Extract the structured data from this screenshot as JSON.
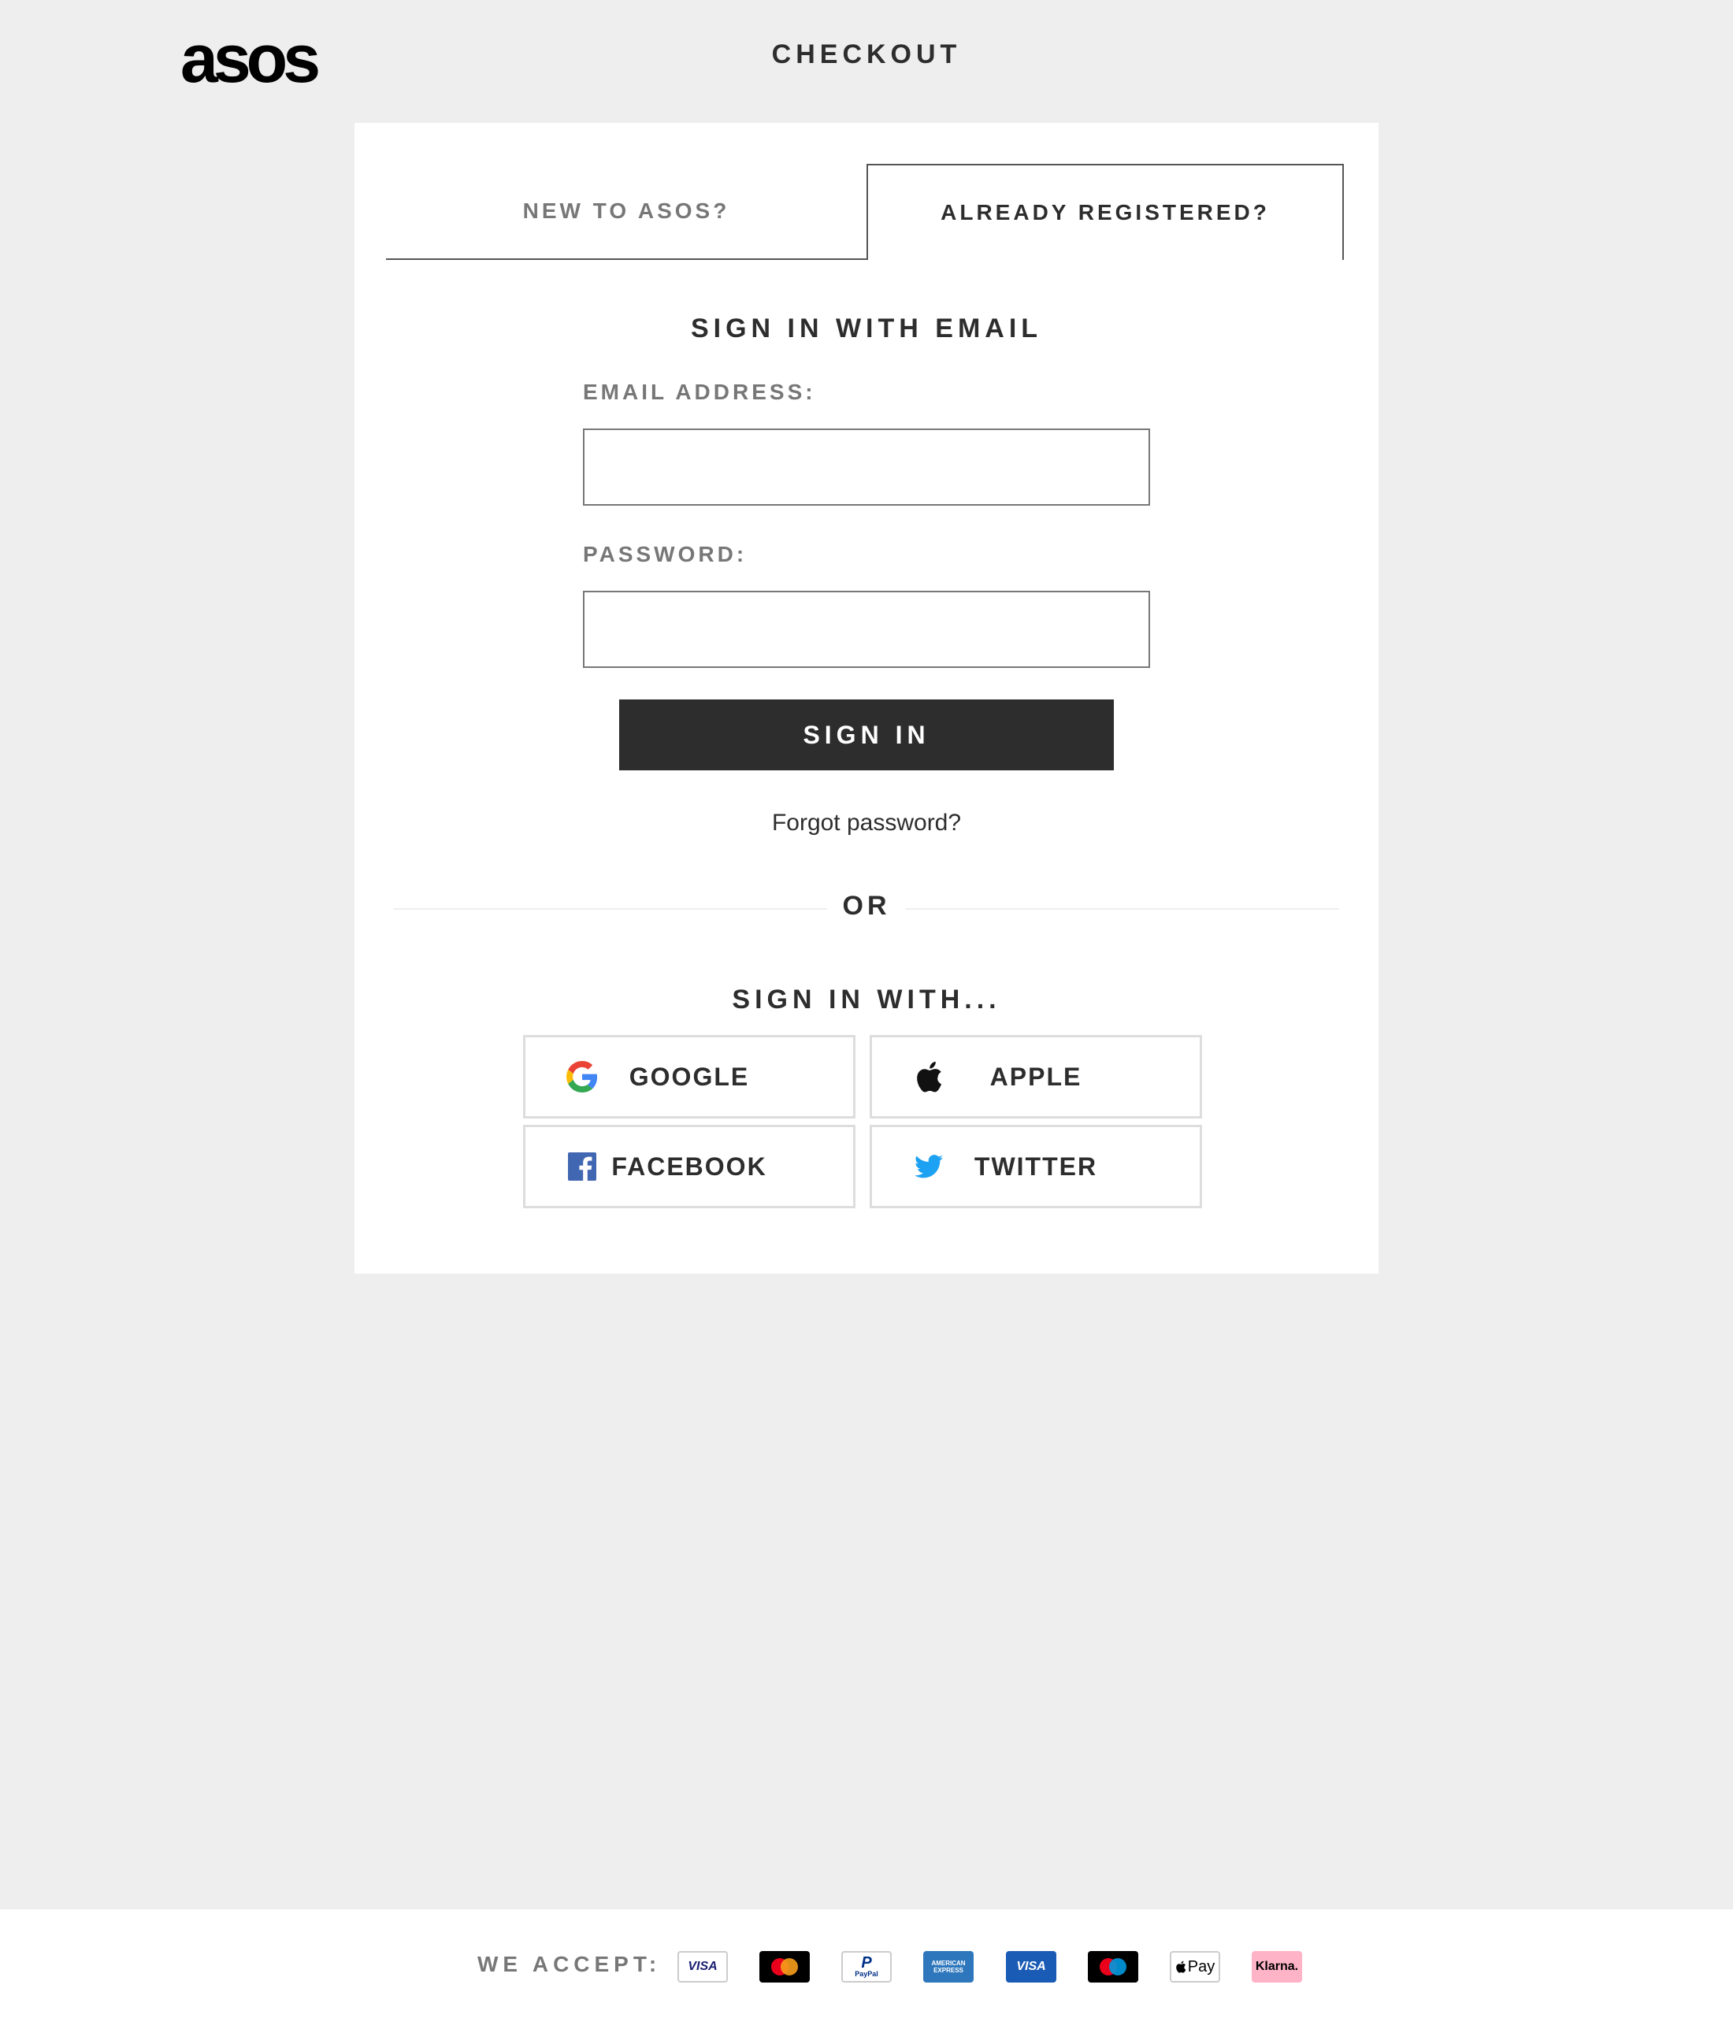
{
  "header": {
    "logo_text": "asos",
    "title": "CHECKOUT"
  },
  "tabs": {
    "new": "NEW TO ASOS?",
    "registered": "ALREADY REGISTERED?"
  },
  "form": {
    "heading": "SIGN IN WITH EMAIL",
    "email_label": "EMAIL ADDRESS:",
    "email_value": "",
    "password_label": "PASSWORD:",
    "password_value": "",
    "submit_label": "SIGN IN",
    "forgot_label": "Forgot password?"
  },
  "divider": {
    "or_label": "OR"
  },
  "social": {
    "heading": "SIGN IN WITH...",
    "google": "GOOGLE",
    "apple": "APPLE",
    "facebook": "FACEBOOK",
    "twitter": "TWITTER"
  },
  "footer": {
    "accept_label": "WE ACCEPT:",
    "payment_methods": [
      "visa",
      "mastercard",
      "paypal",
      "american-express",
      "visa-electron",
      "maestro",
      "apple-pay",
      "klarna"
    ],
    "visa_text": "VISA",
    "paypal_text": "PayPal",
    "amex_text": "AMERICAN EXPRESS",
    "visa_electron_text": "VISA",
    "applepay_text": "Pay",
    "klarna_text": "Klarna."
  },
  "colors": {
    "page_bg": "#eeeeee",
    "card_bg": "#ffffff",
    "primary_button": "#2d2d2d",
    "muted_text": "#777777",
    "facebook_blue": "#4267b2",
    "twitter_blue": "#1da1f2"
  }
}
